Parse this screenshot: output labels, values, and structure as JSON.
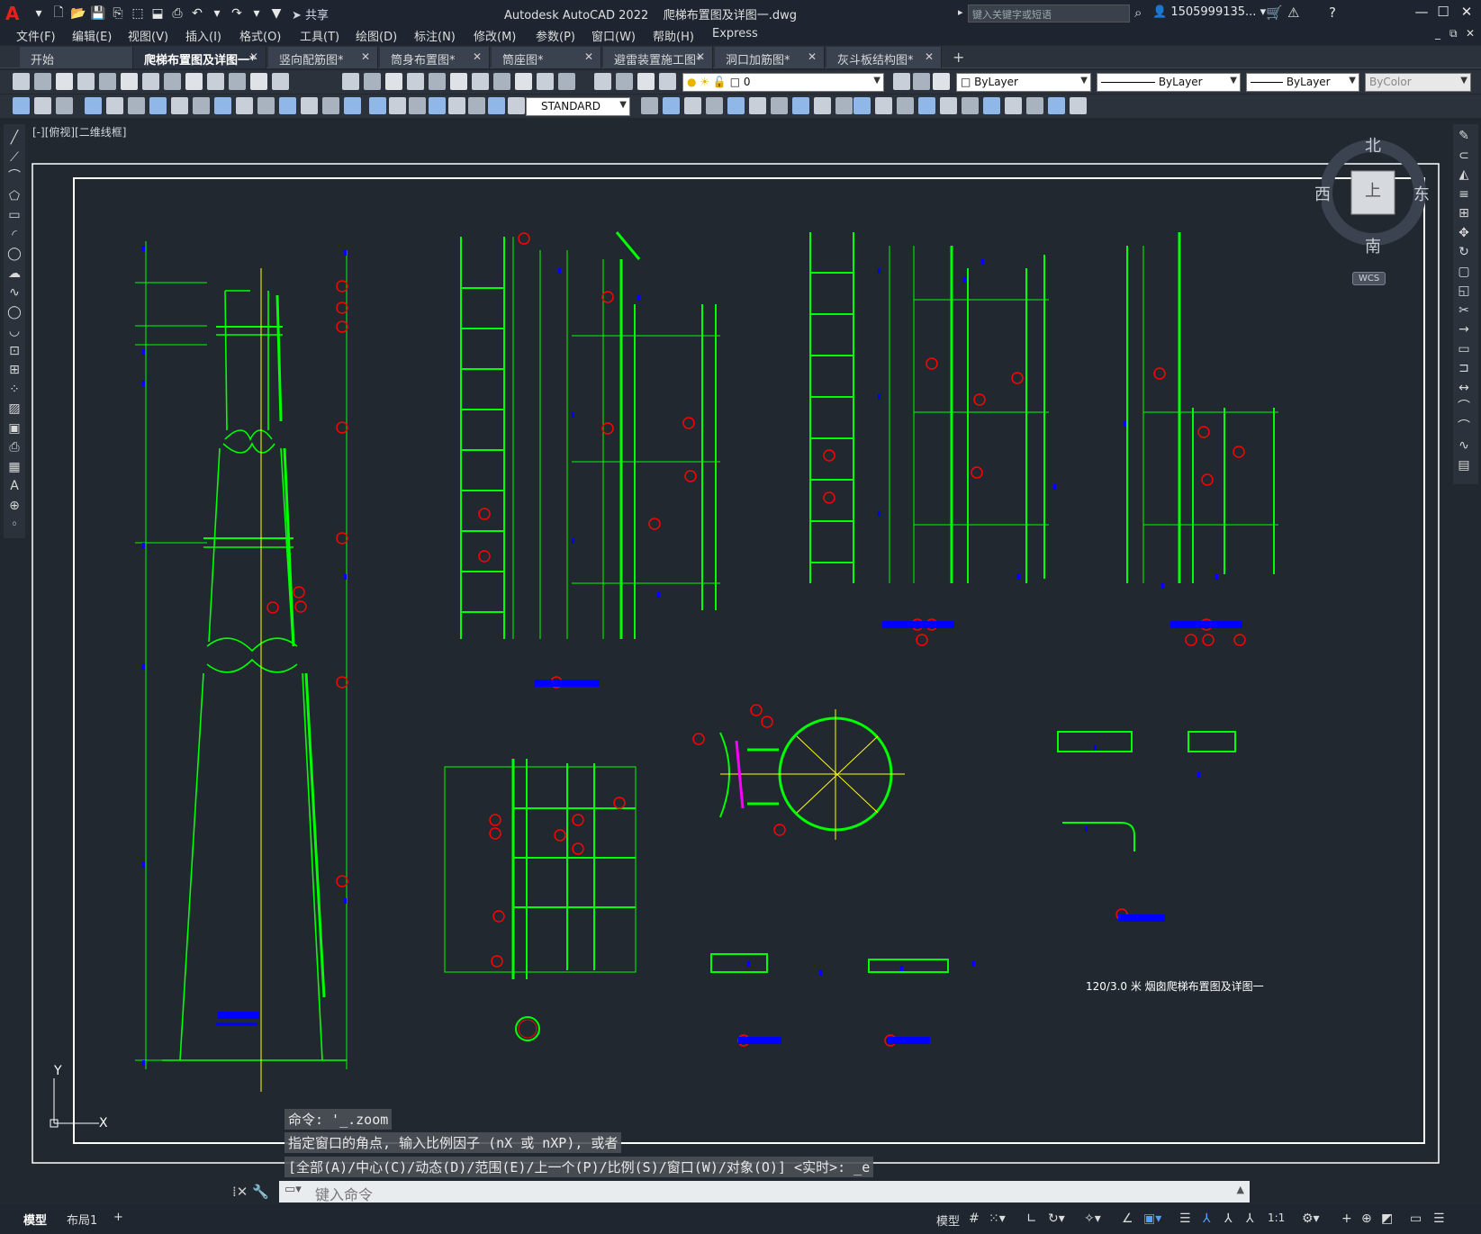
{
  "app": {
    "title": "Autodesk AutoCAD 2022    爬梯布置图及详图一.dwg",
    "share_label": "共享",
    "search_placeholder": "键入关键字或短语",
    "account": "1505999135...",
    "logo": "A"
  },
  "menu": [
    "文件(F)",
    "编辑(E)",
    "视图(V)",
    "插入(I)",
    "格式(O)",
    "工具(T)",
    "绘图(D)",
    "标注(N)",
    "修改(M)",
    "参数(P)",
    "窗口(W)",
    "帮助(H)",
    "Express"
  ],
  "tabs": [
    {
      "label": "开始",
      "closable": false,
      "active": false
    },
    {
      "label": "爬梯布置图及详图一*",
      "closable": true,
      "active": true
    },
    {
      "label": "竖向配筋图*",
      "closable": true,
      "active": false
    },
    {
      "label": "筒身布置图*",
      "closable": true,
      "active": false
    },
    {
      "label": "筒座图*",
      "closable": true,
      "active": false
    },
    {
      "label": "避雷装置施工图*",
      "closable": true,
      "active": false
    },
    {
      "label": "洞口加筋图*",
      "closable": true,
      "active": false
    },
    {
      "label": "灰斗板结构图*",
      "closable": true,
      "active": false
    }
  ],
  "toolbar": {
    "layer_value": "0",
    "color_value": "ByLayer",
    "linetype_value": "ByLayer",
    "lineweight_value": "ByLayer",
    "plotstyle_value": "ByColor",
    "textstyle_value": "STANDARD"
  },
  "viewport": {
    "label": "[-][俯视][二维线框]",
    "viewcube": {
      "north": "北",
      "south": "南",
      "east": "东",
      "west": "西",
      "top": "上",
      "wcs": "WCS"
    },
    "drawing_title": "120/3.0 米 烟囱爬梯布置图及详图一",
    "ucs_y": "Y",
    "ucs_x": "X"
  },
  "command": {
    "history": [
      "命令: '_.zoom",
      "指定窗口的角点, 输入比例因子 (nX 或 nXP), 或者",
      "[全部(A)/中心(C)/动态(D)/范围(E)/上一个(P)/比例(S)/窗口(W)/对象(O)] <实时>: _e"
    ],
    "placeholder": "键入命令"
  },
  "status": {
    "layouts": [
      "模型",
      "布局1"
    ],
    "model_label": "模型",
    "scale": "1:1"
  },
  "colors": {
    "drawing_bg": "#212830",
    "geometry": "#00ff00",
    "dim": "#0000ff",
    "callout": "#ff0000",
    "center": "#ffff00",
    "frame": "#ffffff"
  }
}
